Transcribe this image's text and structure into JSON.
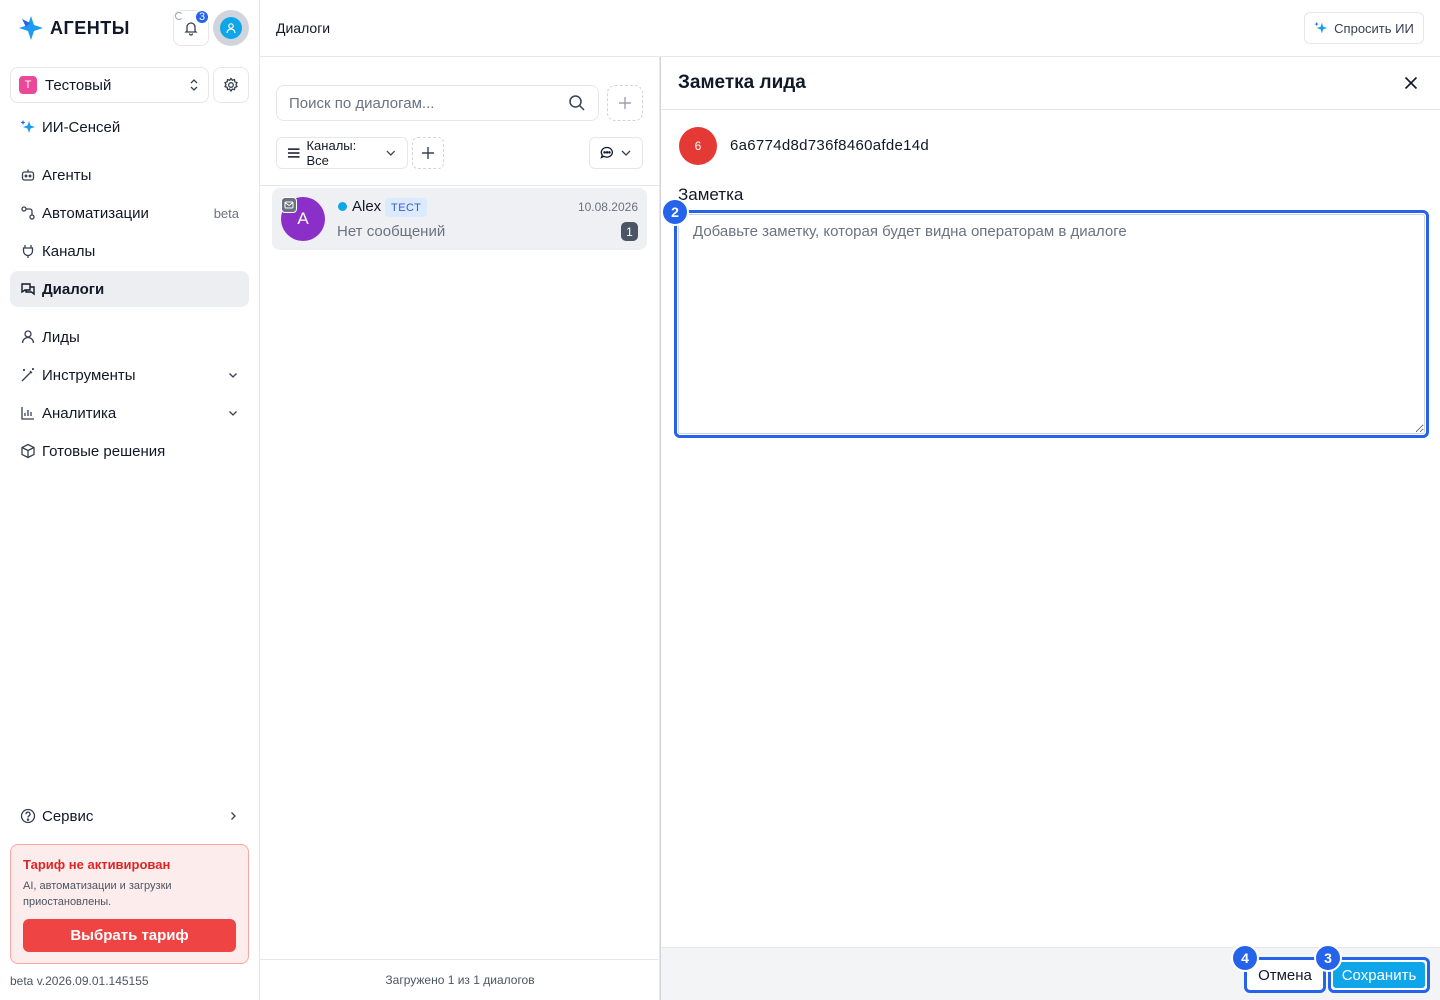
{
  "brand": {
    "name": "АГЕНТЫ"
  },
  "header": {
    "notifications_count": "3",
    "page_title": "Диалоги",
    "ask_ai_label": "Спросить ИИ"
  },
  "workspace": {
    "badge": "Т",
    "name": "Тестовый"
  },
  "sidebar": {
    "ai_item": "ИИ-Сенсей",
    "items": [
      {
        "label": "Агенты",
        "extra": ""
      },
      {
        "label": "Автоматизации",
        "extra": "beta"
      },
      {
        "label": "Каналы",
        "extra": ""
      },
      {
        "label": "Диалоги",
        "extra": ""
      },
      {
        "label": "Лиды",
        "extra": ""
      },
      {
        "label": "Инструменты",
        "extra": ""
      },
      {
        "label": "Аналитика",
        "extra": ""
      },
      {
        "label": "Готовые решения",
        "extra": ""
      }
    ],
    "service_label": "Сервис"
  },
  "tariff": {
    "title": "Тариф не активирован",
    "text": "AI, автоматизации и загрузки приостановлены.",
    "button": "Выбрать тариф"
  },
  "version": "beta v.2026.09.01.145155",
  "dialogs": {
    "search_placeholder": "Поиск по диалогам...",
    "channels_filter": "Каналы: Все",
    "items": [
      {
        "avatar_letter": "A",
        "name": "Alex",
        "tag": "ТЕСТ",
        "date": "10.08.2026",
        "last_message": "Нет сообщений",
        "unread": "1"
      }
    ],
    "footer": "Загружено 1 из 1 диалогов"
  },
  "note_panel": {
    "title": "Заметка лида",
    "lead_avatar": "6",
    "lead_id": "6a6774d8d736f8460afde14d",
    "label": "Заметка",
    "placeholder": "Добавьте заметку, которая будет видна операторам в диалоге",
    "value": "",
    "cancel_label": "Отмена",
    "save_label": "Сохранить"
  },
  "markers": [
    "2",
    "3",
    "4"
  ],
  "colors": {
    "accent": "#2563eb",
    "save": "#0ea5e9",
    "danger": "#ef4444"
  }
}
